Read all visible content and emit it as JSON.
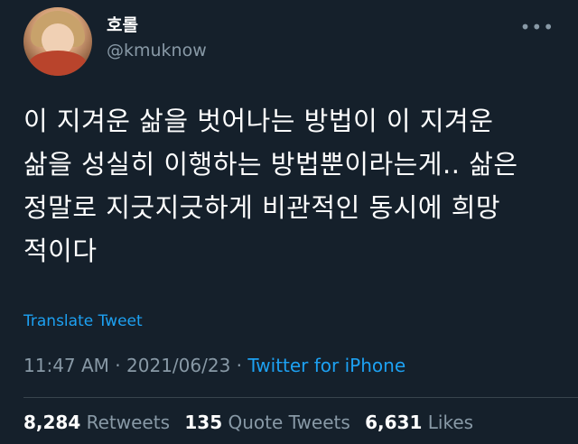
{
  "user": {
    "display_name": "호롤",
    "handle": "@kmuknow"
  },
  "more_icon": "more-horizontal-icon",
  "tweet": {
    "lines": [
      "이 지겨운 삶을 벗어나는 방법이 이 지겨운",
      "삶을 성실히 이행하는 방법뿐이라는게.. 삶은",
      "정말로 지긋지긋하게 비관적인 동시에 희망",
      "적이다"
    ]
  },
  "translate_label": "Translate Tweet",
  "meta": {
    "time": "11:47 AM",
    "sep1": " · ",
    "date": "2021/06/23",
    "sep2": " · ",
    "source": "Twitter for iPhone"
  },
  "stats": {
    "retweets_count": "8,284",
    "retweets_label": "Retweets",
    "quotes_count": "135",
    "quotes_label": "Quote Tweets",
    "likes_count": "6,631",
    "likes_label": "Likes"
  },
  "colors": {
    "background": "#15202b",
    "accent": "#1da1f2",
    "muted": "#8899a6"
  }
}
